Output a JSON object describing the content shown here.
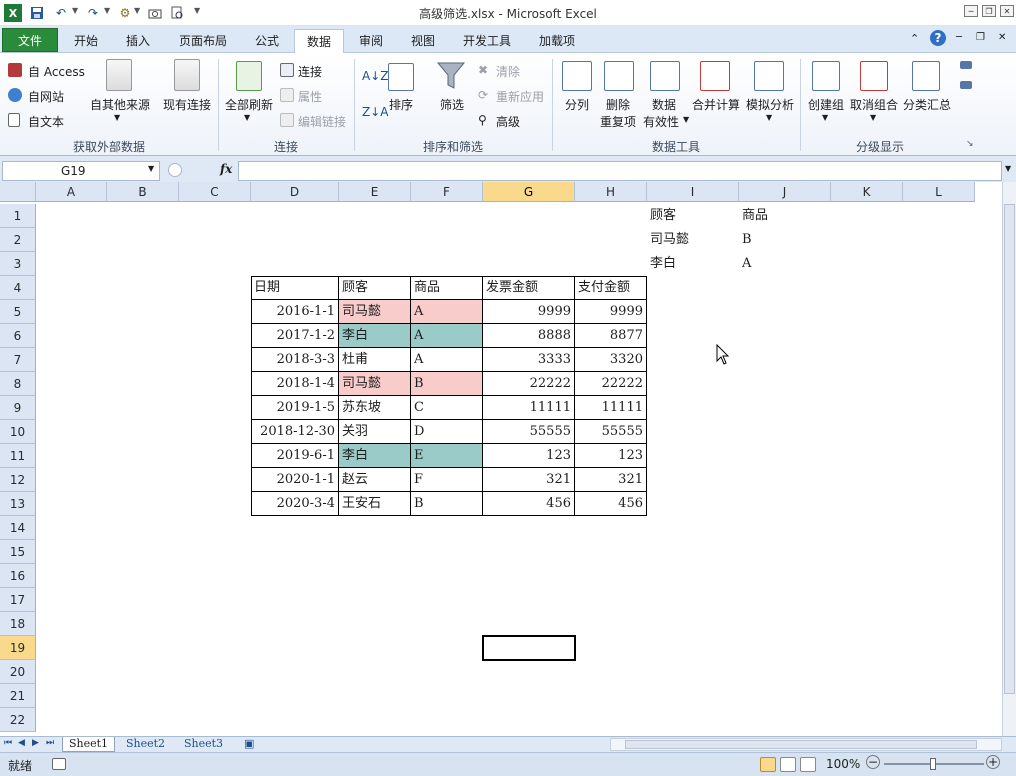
{
  "window": {
    "title": "高级筛选.xlsx - Microsoft Excel"
  },
  "tabs": [
    {
      "label": "文件",
      "key": "file"
    },
    {
      "label": "开始",
      "key": "home"
    },
    {
      "label": "插入",
      "key": "insert"
    },
    {
      "label": "页面布局",
      "key": "layout"
    },
    {
      "label": "公式",
      "key": "formulas"
    },
    {
      "label": "数据",
      "key": "data"
    },
    {
      "label": "审阅",
      "key": "review"
    },
    {
      "label": "视图",
      "key": "view"
    },
    {
      "label": "开发工具",
      "key": "developer"
    },
    {
      "label": "加载项",
      "key": "addins"
    }
  ],
  "ribbon": {
    "external": {
      "access": "自 Access",
      "web": "自网站",
      "text": "自文本",
      "other": "自其他来源",
      "existing": "现有连接",
      "group_label": "获取外部数据"
    },
    "connections": {
      "refresh_all": "全部刷新",
      "connections": "连接",
      "properties": "属性",
      "edit_links": "编辑链接",
      "group_label": "连接"
    },
    "sort_filter": {
      "sort": "排序",
      "filter": "筛选",
      "clear": "清除",
      "reapply": "重新应用",
      "advanced": "高级",
      "group_label": "排序和筛选"
    },
    "data_tools": {
      "text_to_columns": "分列",
      "remove_dup_1": "删除",
      "remove_dup_2": "重复项",
      "validation_1": "数据",
      "validation_2": "有效性",
      "consolidate": "合并计算",
      "what_if": "模拟分析",
      "group_label": "数据工具"
    },
    "outline": {
      "group": "创建组",
      "ungroup": "取消组合",
      "subtotal": "分类汇总",
      "group_label": "分级显示"
    }
  },
  "formula_bar": {
    "name_box": "G19",
    "fx": "fx",
    "content": ""
  },
  "columns": [
    "A",
    "B",
    "C",
    "D",
    "E",
    "F",
    "G",
    "H",
    "I",
    "J",
    "K",
    "L"
  ],
  "selected_column": "G",
  "rows": [
    "1",
    "2",
    "3",
    "4",
    "5",
    "6",
    "7",
    "8",
    "9",
    "10",
    "11",
    "12",
    "13",
    "14",
    "15",
    "16",
    "17",
    "18",
    "19",
    "20",
    "21",
    "22"
  ],
  "selected_row": "19",
  "criteria": {
    "header": [
      "顾客",
      "商品"
    ],
    "rows": [
      [
        "司马懿",
        "B"
      ],
      [
        "李白",
        "A"
      ]
    ]
  },
  "table": {
    "header": [
      "日期",
      "顾客",
      "商品",
      "发票金额",
      "支付金额"
    ],
    "rows": [
      {
        "date": "2016-1-1",
        "customer": "司马懿",
        "product": "A",
        "invoice": "9999",
        "paid": "9999",
        "hl": "pink"
      },
      {
        "date": "2017-1-2",
        "customer": "李白",
        "product": "A",
        "invoice": "8888",
        "paid": "8877",
        "hl": "teal"
      },
      {
        "date": "2018-3-3",
        "customer": "杜甫",
        "product": "A",
        "invoice": "3333",
        "paid": "3320",
        "hl": ""
      },
      {
        "date": "2018-1-4",
        "customer": "司马懿",
        "product": "B",
        "invoice": "22222",
        "paid": "22222",
        "hl": "pink"
      },
      {
        "date": "2019-1-5",
        "customer": "苏东坡",
        "product": "C",
        "invoice": "11111",
        "paid": "11111",
        "hl": ""
      },
      {
        "date": "2018-12-30",
        "customer": "关羽",
        "product": "D",
        "invoice": "55555",
        "paid": "55555",
        "hl": ""
      },
      {
        "date": "2019-6-1",
        "customer": "李白",
        "product": "E",
        "invoice": "123",
        "paid": "123",
        "hl": "teal"
      },
      {
        "date": "2020-1-1",
        "customer": "赵云",
        "product": "F",
        "invoice": "321",
        "paid": "321",
        "hl": ""
      },
      {
        "date": "2020-3-4",
        "customer": "王安石",
        "product": "B",
        "invoice": "456",
        "paid": "456",
        "hl": ""
      }
    ]
  },
  "sheets": [
    {
      "label": "Sheet1",
      "active": true
    },
    {
      "label": "Sheet2",
      "active": false
    },
    {
      "label": "Sheet3",
      "active": false
    }
  ],
  "status": {
    "ready": "就绪",
    "zoom": "100%"
  },
  "colors": {
    "pink": "#f9cccc",
    "teal": "#9acbc9",
    "file_tab": "#2a8b3a",
    "selected_header": "#f9d98b"
  }
}
